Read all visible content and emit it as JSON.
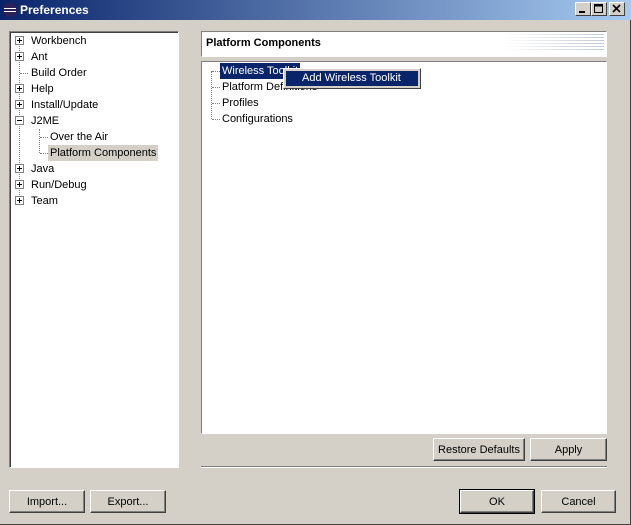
{
  "window": {
    "title": "Preferences",
    "controls": [
      "minimize",
      "maximize",
      "close"
    ]
  },
  "tree": {
    "items": [
      {
        "label": "Workbench",
        "expander": "plus"
      },
      {
        "label": "Ant",
        "expander": "plus"
      },
      {
        "label": "Build Order",
        "expander": "none"
      },
      {
        "label": "Help",
        "expander": "plus"
      },
      {
        "label": "Install/Update",
        "expander": "plus"
      },
      {
        "label": "J2ME",
        "expander": "minus"
      },
      {
        "label": "Over the Air",
        "expander": "child"
      },
      {
        "label": "Platform Components",
        "expander": "child",
        "selected": true
      },
      {
        "label": "Java",
        "expander": "plus"
      },
      {
        "label": "Run/Debug",
        "expander": "plus"
      },
      {
        "label": "Team",
        "expander": "plus"
      }
    ]
  },
  "page": {
    "title": "Platform Components",
    "tree_items": [
      {
        "label": "Wireless Toolkit",
        "highlighted": true
      },
      {
        "label": "Platform Definitions"
      },
      {
        "label": "Profiles"
      },
      {
        "label": "Configurations"
      }
    ],
    "context_menu": {
      "item": "Add Wireless Toolkit"
    },
    "restore_defaults_label": "Restore Defaults",
    "apply_label": "Apply"
  },
  "footer": {
    "import_label": "Import...",
    "export_label": "Export...",
    "ok_label": "OK",
    "cancel_label": "Cancel"
  },
  "colors": {
    "titlebar": "#0a246a",
    "selection": "#0a246a",
    "face": "#d4d0c8"
  }
}
